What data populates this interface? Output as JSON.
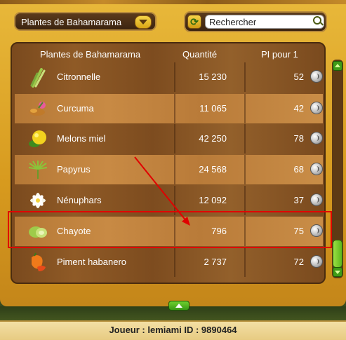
{
  "header": {
    "dropdown_label": "Plantes de Bahamarama",
    "search_placeholder": "Rechercher"
  },
  "table": {
    "headers": [
      "Plantes de Bahamarama",
      "Quantité",
      "PI pour 1"
    ],
    "rows": [
      {
        "name": "Citronnelle",
        "qty": "15 230",
        "pi": "52",
        "icon": "lemongrass-icon"
      },
      {
        "name": "Curcuma",
        "qty": "11 065",
        "pi": "42",
        "icon": "turmeric-icon"
      },
      {
        "name": "Melons miel",
        "qty": "42 250",
        "pi": "78",
        "icon": "honey-melon-icon"
      },
      {
        "name": "Papyrus",
        "qty": "24 568",
        "pi": "68",
        "icon": "papyrus-icon"
      },
      {
        "name": "Nénuphars",
        "qty": "12 092",
        "pi": "37",
        "icon": "water-lily-icon"
      },
      {
        "name": "Chayote",
        "qty": "796",
        "pi": "75",
        "icon": "chayote-icon"
      },
      {
        "name": "Piment habanero",
        "qty": "2 737",
        "pi": "72",
        "icon": "habanero-icon"
      }
    ]
  },
  "footer": {
    "player_text": "Joueur : lemiami   ID : 9890464"
  },
  "colors": {
    "highlight": "#e00000",
    "frame": "#d79a1e",
    "panel": "#8f5a26"
  }
}
